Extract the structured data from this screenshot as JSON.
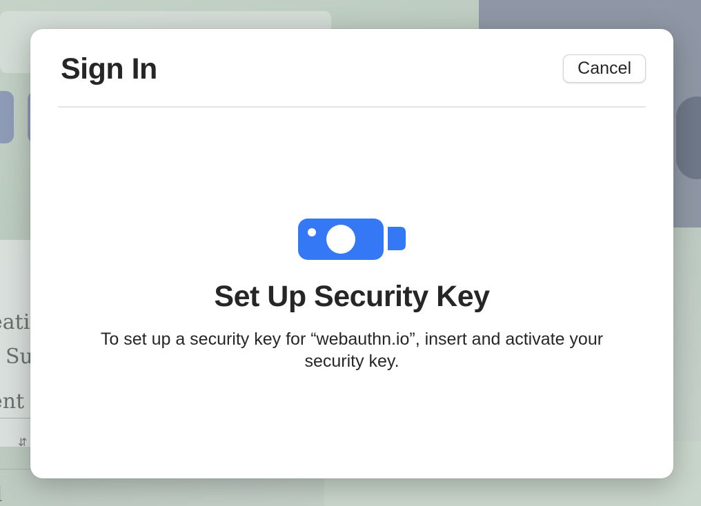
{
  "dialog": {
    "title": "Sign In",
    "cancel_label": "Cancel",
    "icon": "security-key-icon",
    "heading": "Set Up Security Key",
    "description": "To set up a security key for “webauthn.io”, insert and activate your security key."
  },
  "background": {
    "ghost_texts": [
      "eati",
      "Su",
      "ent",
      "l"
    ]
  },
  "colors": {
    "accent": "#3478f6",
    "sheet": "#ffffff",
    "text": "#262626"
  }
}
